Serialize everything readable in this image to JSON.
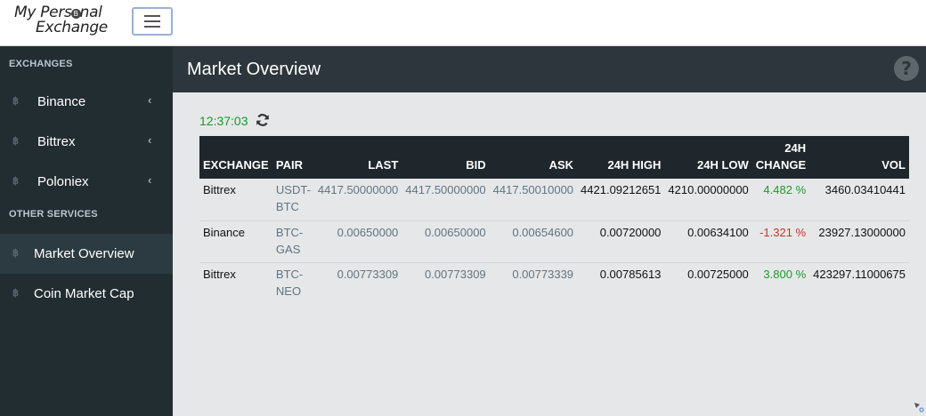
{
  "brand": {
    "line1": "My Pers",
    "coin": "B",
    "line1b": "nal",
    "line2": "Exchange"
  },
  "sidebar": {
    "section_exchanges": "EXCHANGES",
    "exchanges": [
      {
        "label": "Binance",
        "icon": "bitcoin-icon",
        "chevron": "‹"
      },
      {
        "label": "Bittrex",
        "icon": "bitcoin-icon",
        "chevron": "‹"
      },
      {
        "label": "Poloniex",
        "icon": "bitcoin-icon",
        "chevron": "‹"
      }
    ],
    "section_other": "OTHER SERVICES",
    "services": [
      {
        "label": "Market Overview",
        "icon": "bitcoin-icon",
        "active": true
      },
      {
        "label": "Coin Market Cap",
        "icon": "bitcoin-icon",
        "active": false
      }
    ],
    "icon_glyph": "฿"
  },
  "header": {
    "title": "Market Overview",
    "help": "?"
  },
  "market": {
    "time": "12:37:03",
    "columns": {
      "exchange": "EXCHANGE",
      "pair": "PAIR",
      "last": "LAST",
      "bid": "BID",
      "ask": "ASK",
      "high": "24H HIGH",
      "low": "24H LOW",
      "change_1": "24H",
      "change_2": "CHANGE",
      "vol": "VOL"
    },
    "rows": [
      {
        "exchange": "Bittrex",
        "pair_1": "USDT-",
        "pair_2": "BTC",
        "last": "4417.50000000",
        "bid": "4417.50000000",
        "ask": "4417.50010000",
        "high": "4421.09212651",
        "low": "4210.00000000",
        "change": "4.482 %",
        "vol": "3460.03410441"
      },
      {
        "exchange": "Binance",
        "pair_1": "BTC-",
        "pair_2": "GAS",
        "last": "0.00650000",
        "bid": "0.00650000",
        "ask": "0.00654600",
        "high": "0.00720000",
        "low": "0.00634100",
        "change": "-1.321 %",
        "vol": "23927.13000000"
      },
      {
        "exchange": "Bittrex",
        "pair_1": "BTC-",
        "pair_2": "NEO",
        "last": "0.00773309",
        "bid": "0.00773309",
        "ask": "0.00773339",
        "high": "0.00785613",
        "low": "0.00725000",
        "change": "3.800 %",
        "vol": "423297.11000675"
      }
    ]
  },
  "colors": {
    "positive": "#1e9a2e",
    "negative": "#c0392b",
    "sidebar_bg": "#222d32",
    "header_bg": "#2c363c"
  }
}
